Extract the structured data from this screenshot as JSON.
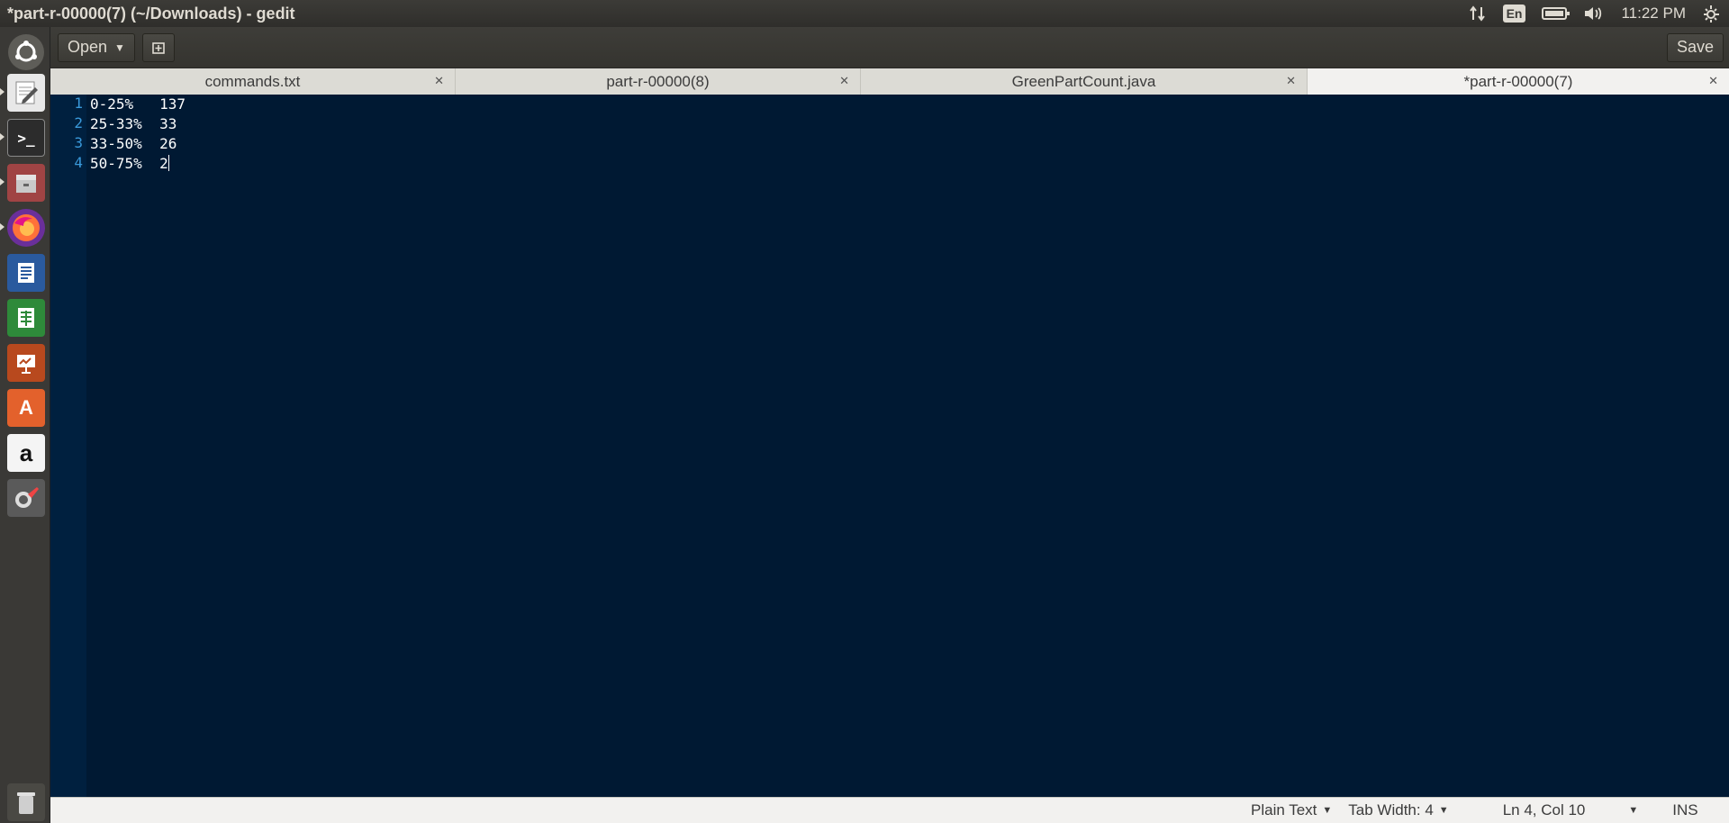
{
  "window": {
    "title": "*part-r-00000(7) (~/Downloads) - gedit"
  },
  "panel": {
    "lang": "En",
    "time": "11:22 PM"
  },
  "toolbar": {
    "open_label": "Open",
    "save_label": "Save"
  },
  "tabs": [
    {
      "label": "commands.txt",
      "active": false
    },
    {
      "label": "part-r-00000(8)",
      "active": false
    },
    {
      "label": "GreenPartCount.java",
      "active": false
    },
    {
      "label": "*part-r-00000(7)",
      "active": true
    }
  ],
  "editor": {
    "lines": [
      {
        "num": "1",
        "text": "0-25%   137"
      },
      {
        "num": "2",
        "text": "25-33%  33"
      },
      {
        "num": "3",
        "text": "33-50%  26"
      },
      {
        "num": "4",
        "text": "50-75%  2"
      }
    ]
  },
  "status": {
    "language": "Plain Text",
    "tab_width": "Tab Width: 4",
    "position": "Ln 4, Col 10",
    "mode": "INS"
  },
  "colors": {
    "editor_bg": "#001933",
    "line_number": "#3a9adb",
    "panel_bg": "#3c3b37",
    "accent": "#e95420"
  }
}
